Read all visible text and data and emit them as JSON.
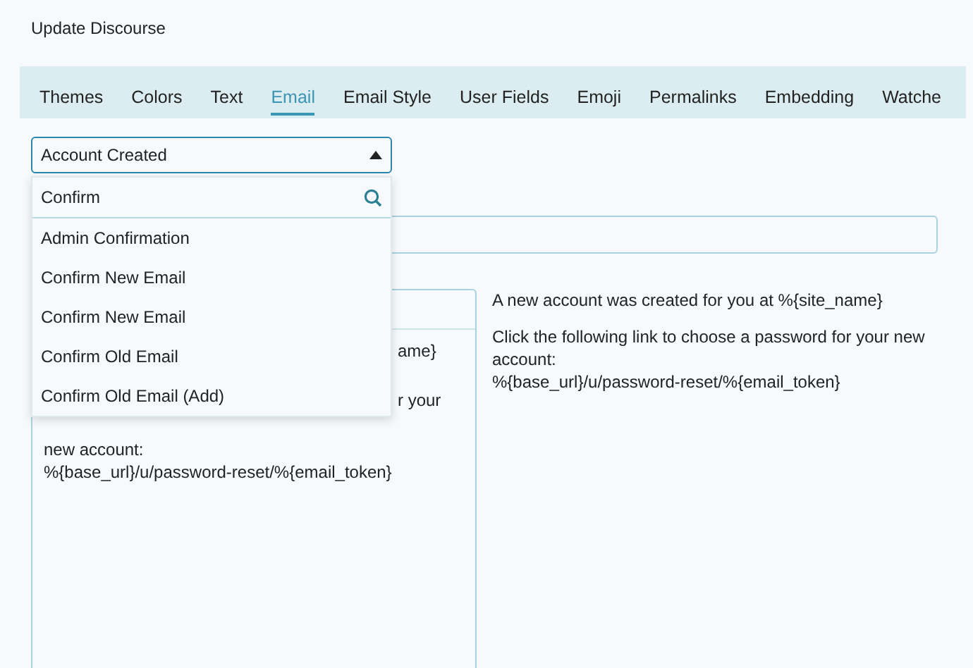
{
  "page_title": "Update Discourse",
  "tabs": [
    {
      "label": "Themes",
      "selected": false
    },
    {
      "label": "Colors",
      "selected": false
    },
    {
      "label": "Text",
      "selected": false
    },
    {
      "label": "Email",
      "selected": true
    },
    {
      "label": "Email Style",
      "selected": false
    },
    {
      "label": "User Fields",
      "selected": false
    },
    {
      "label": "Emoji",
      "selected": false
    },
    {
      "label": "Permalinks",
      "selected": false
    },
    {
      "label": "Embedding",
      "selected": false
    },
    {
      "label": "Watche",
      "selected": false
    }
  ],
  "template_select": {
    "value": "Account Created",
    "expanded": true,
    "filter": {
      "value": "Confirm"
    },
    "options": [
      {
        "label": "Admin Confirmation"
      },
      {
        "label": "Confirm New Email"
      },
      {
        "label": "Confirm New Email"
      },
      {
        "label": "Confirm Old Email"
      },
      {
        "label": "Confirm Old Email (Add)"
      }
    ]
  },
  "editor": {
    "lines": [
      {
        "kind": "tail",
        "text": "ame}"
      },
      {
        "kind": "tail",
        "text": "r your"
      },
      {
        "kind": "full",
        "text": "new account:"
      },
      {
        "kind": "full",
        "text": "%{base_url}/u/password-reset/%{email_token}"
      }
    ]
  },
  "preview": {
    "paragraphs": [
      "A new account was created for you at %{site_name}",
      "Click the following link to choose a password for your new account:\n%{base_url}/u/password-reset/%{email_token}"
    ]
  }
}
